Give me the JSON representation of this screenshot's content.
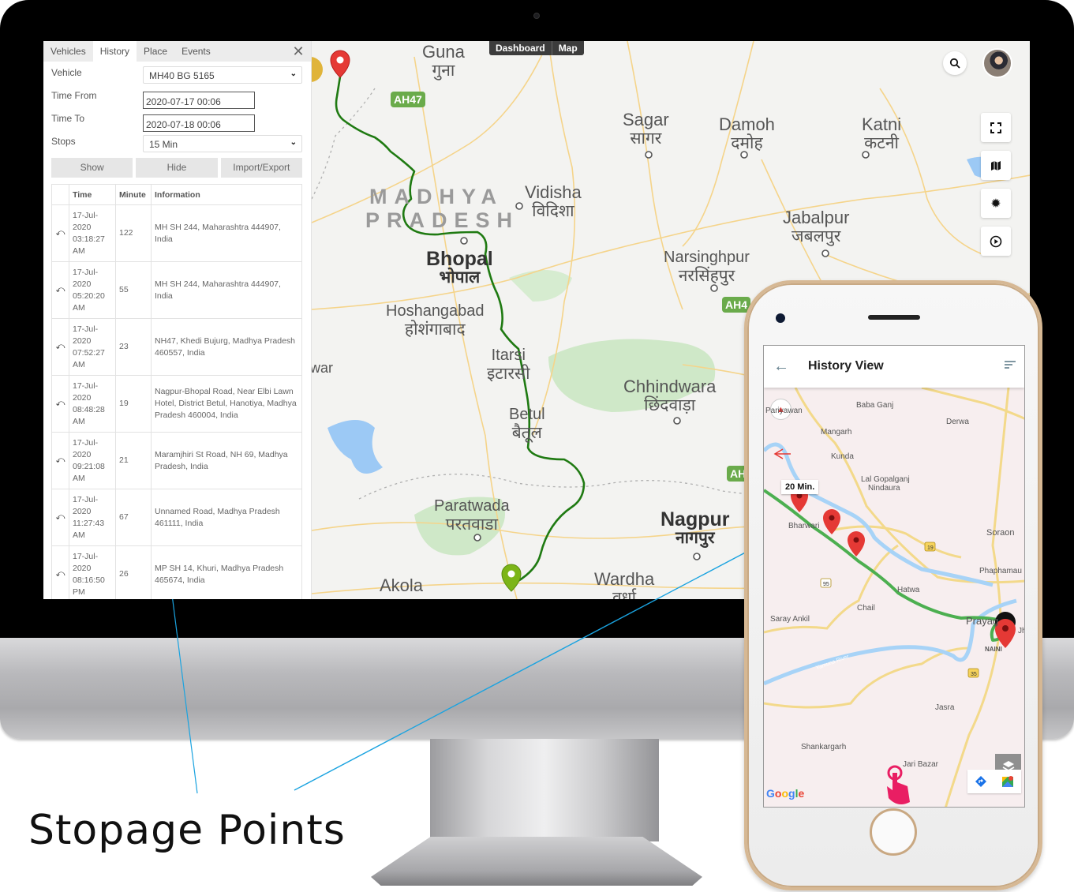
{
  "desktop_app": {
    "tabs": [
      {
        "label": "Vehicles",
        "active": false
      },
      {
        "label": "History",
        "active": true
      },
      {
        "label": "Place",
        "active": false
      },
      {
        "label": "Events",
        "active": false
      }
    ],
    "close_icon": "close-icon",
    "form": {
      "vehicle_label": "Vehicle",
      "vehicle_value": "MH40 BG 5165",
      "time_from_label": "Time From",
      "time_from_value": "2020-07-17 00:06",
      "time_to_label": "Time To",
      "time_to_value": "2020-07-18 00:06",
      "stops_label": "Stops",
      "stops_value": "15 Min"
    },
    "buttons": {
      "show": "Show",
      "hide": "Hide",
      "import_export": "Import/Export"
    },
    "table": {
      "headers": [
        "",
        "Time",
        "Minute",
        "Information"
      ],
      "rows": [
        {
          "time": "17-Jul-2020 03:18:27 AM",
          "minute": "122",
          "info": "MH SH 244, Maharashtra 444907, India"
        },
        {
          "time": "17-Jul-2020 05:20:20 AM",
          "minute": "55",
          "info": "MH SH 244, Maharashtra 444907, India"
        },
        {
          "time": "17-Jul-2020 07:52:27 AM",
          "minute": "23",
          "info": "NH47, Khedi Bujurg, Madhya Pradesh 460557, India"
        },
        {
          "time": "17-Jul-2020 08:48:28 AM",
          "minute": "19",
          "info": "Nagpur-Bhopal Road, Near Elbi Lawn Hotel, District Betul, Hanotiya, Madhya Pradesh 460004, India"
        },
        {
          "time": "17-Jul-2020 09:21:08 AM",
          "minute": "21",
          "info": "Maramjhiri St Road, NH 69, Madhya Pradesh, India"
        },
        {
          "time": "17-Jul-2020 11:27:43 AM",
          "minute": "67",
          "info": "Unnamed Road, Madhya Pradesh 461111, India"
        },
        {
          "time": "17-Jul-2020 08:16:50 PM",
          "minute": "26",
          "info": "MP SH 14, Khuri, Madhya Pradesh 465674, India"
        }
      ]
    },
    "top_nav": {
      "dashboard": "Dashboard",
      "map": "Map"
    },
    "map_controls": [
      "fullscreen-icon",
      "map-layers-icon",
      "settings-icon",
      "play-icon"
    ],
    "map": {
      "state_label_1": "MADHYA",
      "state_label_2": "PRADESH",
      "highway_badges": [
        "AH47",
        "AH4",
        "AH"
      ],
      "cities": [
        {
          "id": "guna",
          "en": "Guna",
          "hi": "गुना"
        },
        {
          "id": "sagar",
          "en": "Sagar",
          "hi": "सागर"
        },
        {
          "id": "damoh",
          "en": "Damoh",
          "hi": "दमोह"
        },
        {
          "id": "katni",
          "en": "Katni",
          "hi": "कटनी"
        },
        {
          "id": "vidisha",
          "en": "Vidisha",
          "hi": "विदिशा"
        },
        {
          "id": "jabalpur",
          "en": "Jabalpur",
          "hi": "जबलपुर"
        },
        {
          "id": "bhopal",
          "en": "Bhopal",
          "hi": "भोपाल"
        },
        {
          "id": "narsinghpur",
          "en": "Narsinghpur",
          "hi": "नरसिंहपुर"
        },
        {
          "id": "hoshangabad",
          "en": "Hoshangabad",
          "hi": "होशंगाबाद"
        },
        {
          "id": "itarsi",
          "en": "Itarsi",
          "hi": "इटारसी"
        },
        {
          "id": "chhindwara",
          "en": "Chhindwara",
          "hi": "छिंदवाड़ा"
        },
        {
          "id": "betul",
          "en": "Betul",
          "hi": "बैतूल"
        },
        {
          "id": "paratwada",
          "en": "Paratwada",
          "hi": "परतवाडा"
        },
        {
          "id": "nagpur",
          "en": "Nagpur",
          "hi": "नागपुर"
        },
        {
          "id": "wardha",
          "en": "Wardha",
          "hi": "वर्धा"
        },
        {
          "id": "akola",
          "en": "Akola",
          "hi": ""
        },
        {
          "id": "war",
          "en": "war",
          "hi": ""
        }
      ]
    }
  },
  "mobile_app": {
    "title": "History View",
    "back_icon": "arrow-left-icon",
    "filter_icon": "filter-icon",
    "tooltip": "20 Min.",
    "places": [
      "Pariyawan",
      "Baba Ganj",
      "Derwa",
      "Mangarh",
      "Kunda",
      "Lal Gopalganj",
      "Nindaura",
      "Bharwari",
      "Soraon",
      "Phaphamau",
      "Hatwa",
      "Chail",
      "Saray Ankil",
      "Prayag",
      "NAINI",
      "Yamuna River",
      "Jasra",
      "Shankargarh",
      "Jari Bazar",
      "Jh"
    ],
    "road_badges": [
      "19",
      "95",
      "35"
    ],
    "google_logo": "Google"
  },
  "caption": "Stopage Points",
  "colors": {
    "route_desktop": "#1f7a12",
    "route_mobile": "#4caf50",
    "start_marker": "#e53935",
    "end_marker": "#7cb518",
    "callout_line": "#1aa3e0",
    "phone_frame": "#d6b894"
  }
}
